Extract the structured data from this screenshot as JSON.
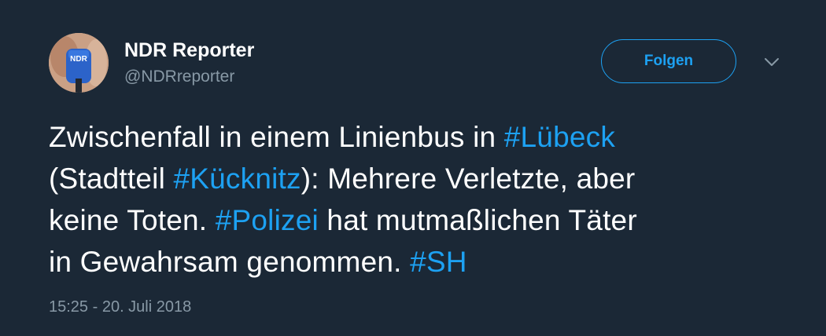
{
  "user": {
    "display_name": "NDR Reporter",
    "handle": "@NDRreporter",
    "avatar_logo_text": "NDR"
  },
  "actions": {
    "follow_label": "Folgen",
    "more_icon": "chevron-down-icon"
  },
  "tweet": {
    "line1_text": "Zwischenfall in einem Linienbus in ",
    "line1_tag": "#Lübeck",
    "line2_open": "(Stadtteil ",
    "line2_tag": "#Kücknitz",
    "line2_text": "): Mehrere Verletzte, aber",
    "line3_text_a": "keine Toten. ",
    "line3_tag": "#Polizei",
    "line3_text_b": " hat mutmaßlichen Täter",
    "line4_text": "in Gewahrsam genommen. ",
    "line4_tag": "#SH",
    "timestamp": "15:25 - 20. Juli 2018"
  },
  "colors": {
    "background": "#1b2836",
    "accent": "#1da1f2",
    "muted": "#8899a6",
    "text": "#ffffff"
  }
}
